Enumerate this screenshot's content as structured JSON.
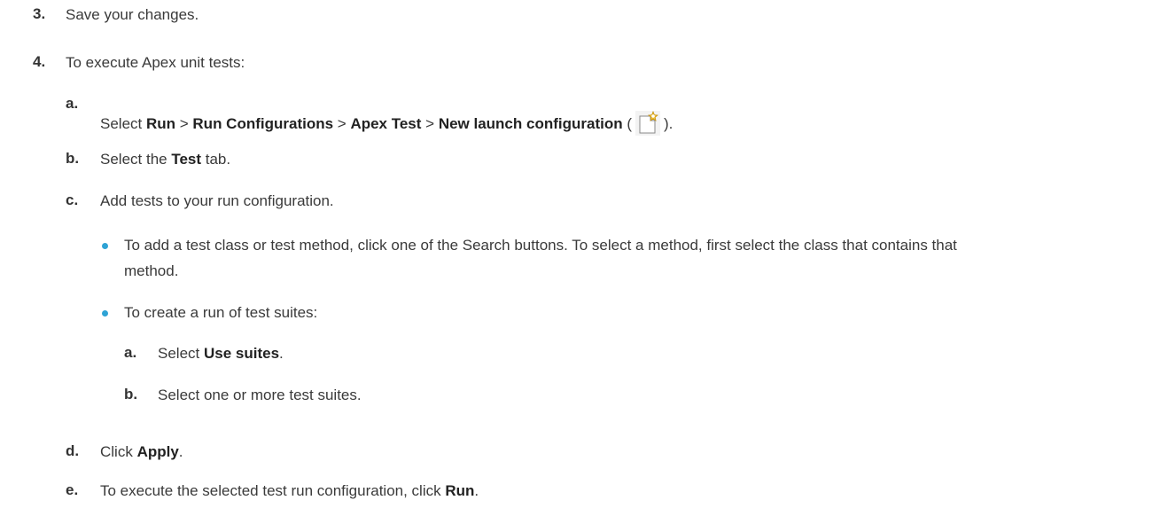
{
  "step3": {
    "num": "3.",
    "text": "Save your changes."
  },
  "step4": {
    "num": "4.",
    "text": "To execute Apex unit tests:"
  },
  "sub_a": {
    "num": "a.",
    "t1": "Select ",
    "b1": "Run",
    "t2": " > ",
    "b2": "Run Configurations",
    "t3": " > ",
    "b3": "Apex Test",
    "t4": " > ",
    "b4": "New launch configuration",
    "t5": " (",
    "t6": ")."
  },
  "sub_b": {
    "num": "b.",
    "t1": "Select the ",
    "b1": "Test",
    "t2": " tab."
  },
  "sub_c": {
    "num": "c.",
    "text": "Add tests to your run configuration."
  },
  "bullet1": {
    "line1": "To add a test class or test method, click one of the Search buttons. To select a method, first select the class that contains that",
    "line2": "method."
  },
  "bullet2": {
    "text": "To create a run of test suites:"
  },
  "nested_a": {
    "num": "a.",
    "t1": "Select ",
    "b1": "Use suites",
    "t2": "."
  },
  "nested_b": {
    "num": "b.",
    "text": "Select one or more test suites."
  },
  "sub_d": {
    "num": "d.",
    "t1": "Click ",
    "b1": "Apply",
    "t2": "."
  },
  "sub_e": {
    "num": "e.",
    "t1": "To execute the selected test run configuration, click ",
    "b1": "Run",
    "t2": "."
  },
  "icons": {
    "new_launch_config": "new-launch-configuration-icon"
  }
}
